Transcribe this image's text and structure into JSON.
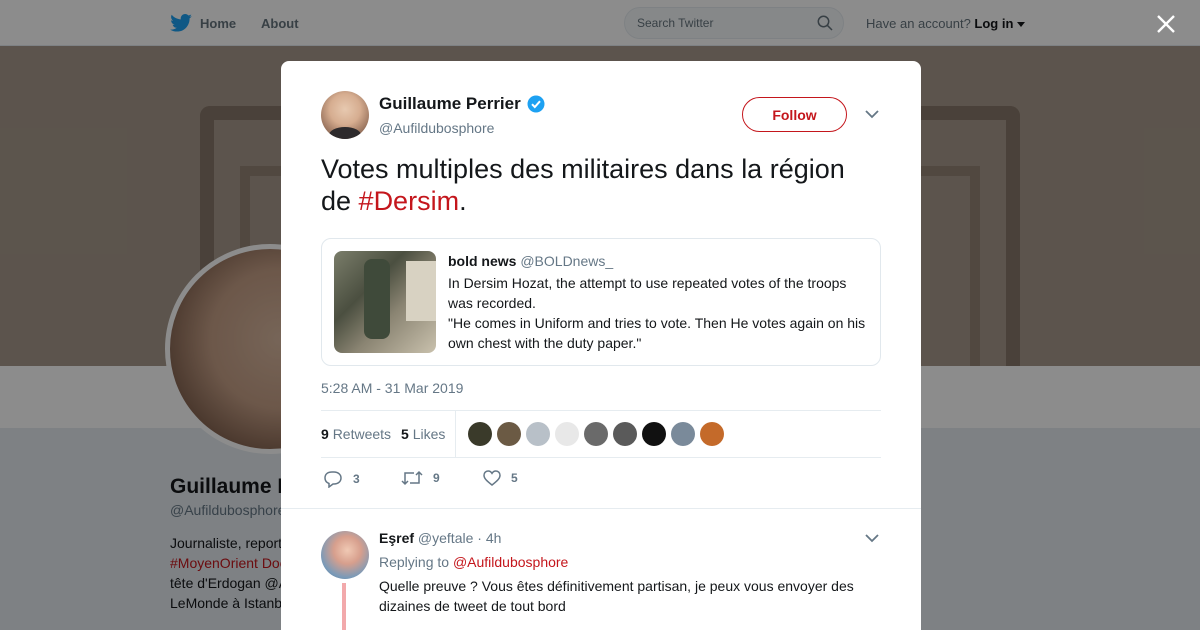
{
  "topnav": {
    "home_label": "Home",
    "about_label": "About",
    "search_placeholder": "Search Twitter",
    "account_prompt": "Have an account?",
    "login_label": "Log in"
  },
  "background_profile": {
    "name": "Guillaume P",
    "handle": "@Aufildubosphore",
    "bio_lines": [
      "Journaliste, report",
      "#MoyenOrient Doc",
      "tête d'Erdogan @A",
      "LeMonde à Istanb"
    ]
  },
  "tweet": {
    "author_name": "Guillaume Perrier",
    "author_handle": "@Aufildubosphore",
    "verified": true,
    "follow_label": "Follow",
    "text_before": "Votes multiples des militaires dans la région de ",
    "hashtag": "#Dersim",
    "text_after": ".",
    "quote": {
      "author_name": "bold news",
      "author_handle": "@BOLDnews_",
      "text_line1": "In Dersim Hozat, the attempt to use repeated votes of the troops was recorded.",
      "text_line2": "\"He comes in Uniform and tries to vote. Then He votes again on his own chest with the duty paper.\""
    },
    "timestamp": "5:28 AM - 31 Mar 2019",
    "retweets_count": "9",
    "retweets_label": "Retweets",
    "likes_count": "5",
    "likes_label": "Likes",
    "liker_colors": [
      "#3a3a2a",
      "#6b5a44",
      "#b8c0c8",
      "#e8e8e8",
      "#6a6a6a",
      "#5a5a5a",
      "#111111",
      "#7a8a9a",
      "#c46a2a"
    ],
    "action_replies": "3",
    "action_retweets": "9",
    "action_likes": "5"
  },
  "reply": {
    "author_name": "Eşref",
    "author_handle": "@yeftale",
    "time": "· 4h",
    "replying_prefix": "Replying to",
    "replying_mention": "@Aufildubosphore",
    "text": "Quelle preuve ? Vous êtes définitivement partisan, je peux vous envoyer des dizaines de tweet de tout bord"
  },
  "colors": {
    "accent": "#c4161c",
    "verified_blue": "#1da1f2",
    "twitter_blue": "#1da1f2"
  }
}
